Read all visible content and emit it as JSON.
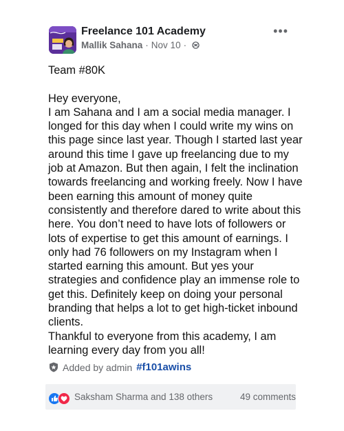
{
  "post": {
    "group_name": "Freelance 101 Academy",
    "author": "Mallik Sahana",
    "separator": "·",
    "date": "Nov 10",
    "more_icon": "more-options-icon",
    "privacy_icon": "globe-icon",
    "team_line": "Team #80K",
    "greeting": "Hey everyone,",
    "body": "I am Sahana and I am a social media manager. I longed for this day when I could write my wins on this page since last year. Though I started last year around this time I gave up freelancing due to my job at Amazon. But then again, I felt the inclination towards freelancing and working freely. Now I have been earning this amount of money quite consistently and therefore dared to write about this here. You don’t need to have lots of followers or lots of expertise to get this amount of earnings. I only had 76 followers on my Instagram when I started earning this amount. But yes your strategies and confidence play an immense role to get this. Definitely keep on doing your personal branding that helps a lot to get high-ticket inbound clients.",
    "closing": "Thankful to everyone from this academy, I am learning every day from you all!"
  },
  "topic": {
    "added_by": "Added by admin",
    "hashtag": "#f101awins",
    "icon": "shield-icon"
  },
  "footer": {
    "reaction_icons": [
      "like-icon",
      "love-icon"
    ],
    "reactors": "Saksham Sharma and 138 others",
    "comments": "49 comments"
  },
  "colors": {
    "hashtag": "#1a4fa8",
    "like": "#1877f2",
    "love": "#f02849",
    "footer_bg": "#f0f1f3",
    "muted": "#65676b"
  }
}
